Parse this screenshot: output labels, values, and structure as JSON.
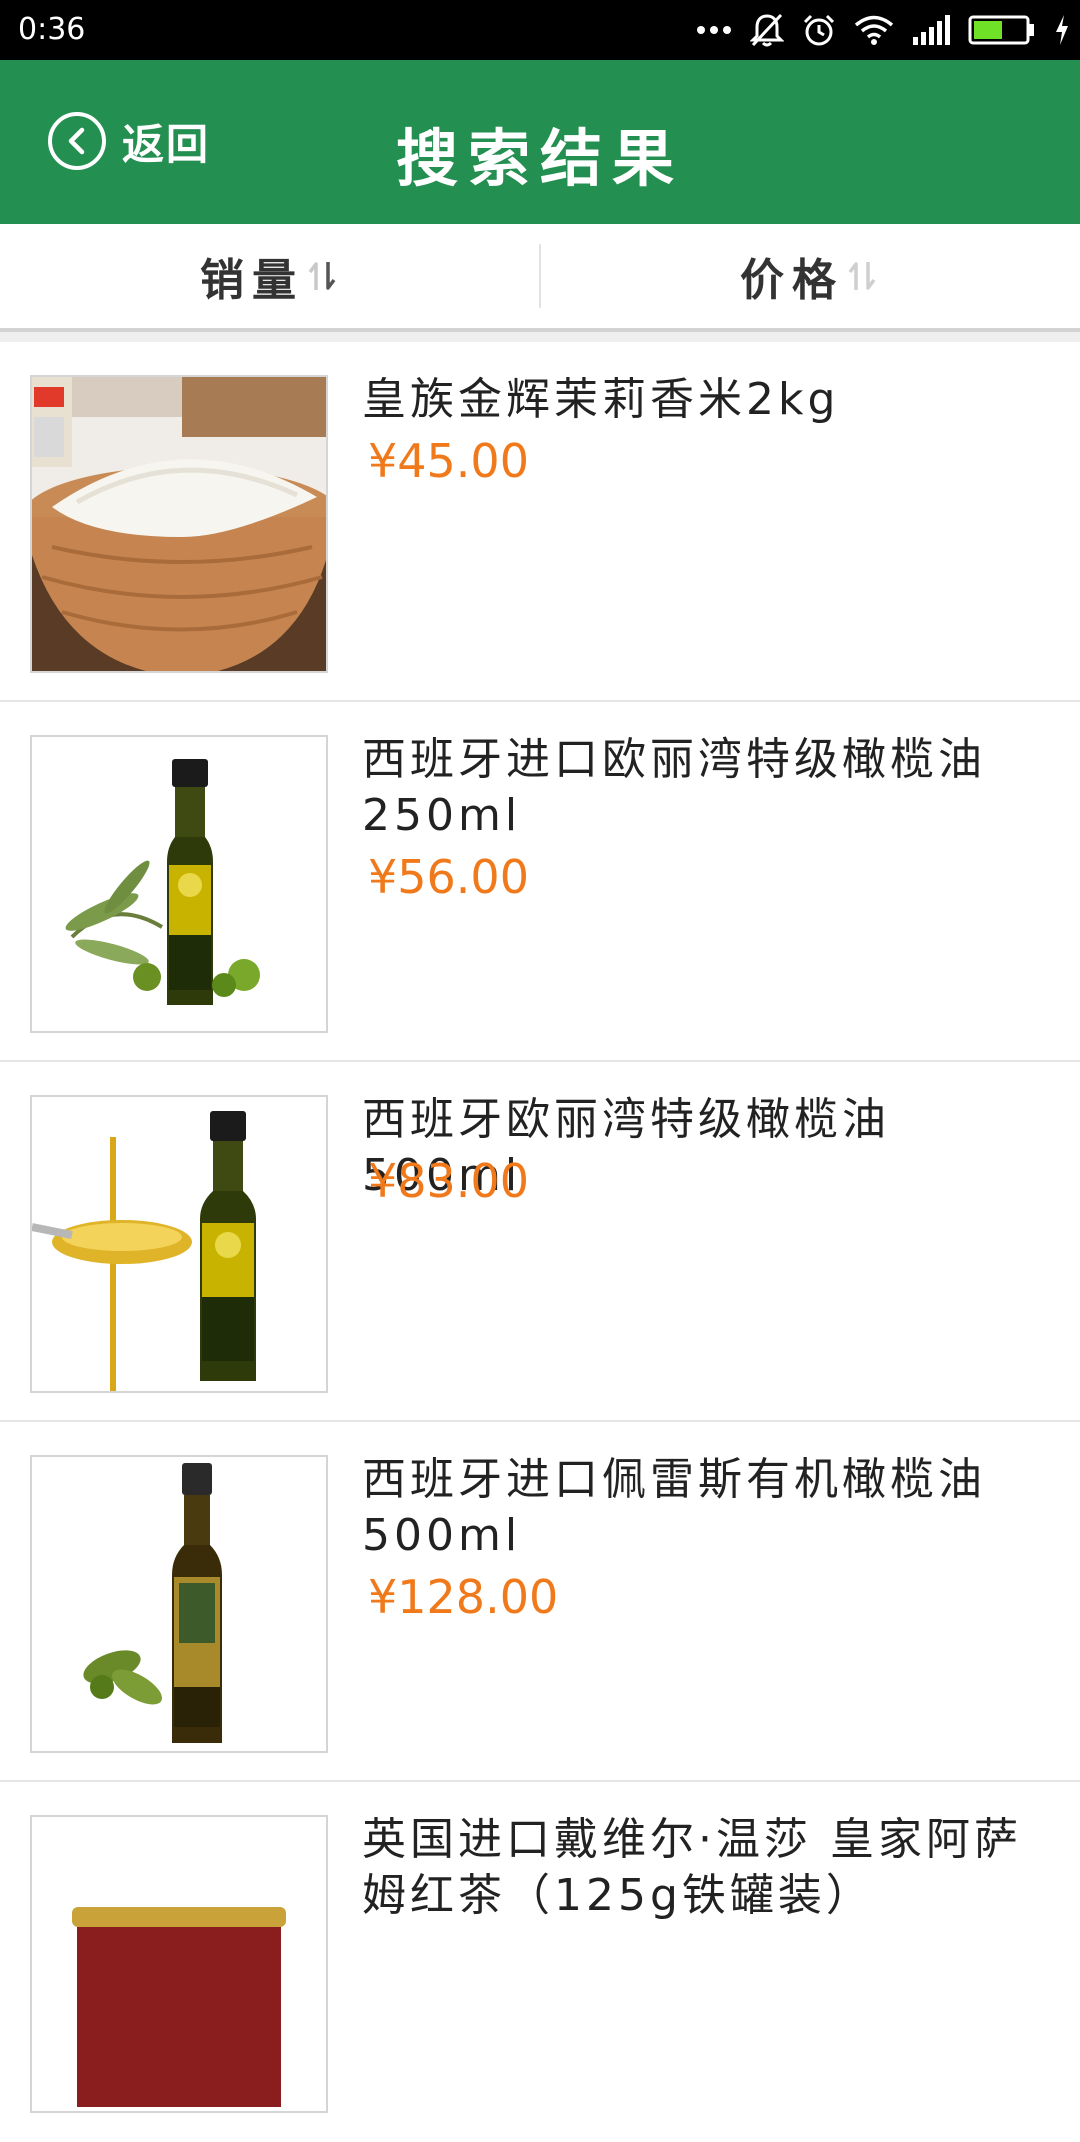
{
  "status_bar": {
    "time": "0:36",
    "icons": [
      "more-dots-icon",
      "mute-bell-icon",
      "alarm-icon",
      "wifi-icon",
      "signal-icon",
      "battery-icon",
      "charging-icon"
    ]
  },
  "header": {
    "back_label": "返回",
    "title": "搜索结果",
    "background_color": "#238f51"
  },
  "sort": {
    "sales_label": "销量",
    "price_label": "价格"
  },
  "products": [
    {
      "name": "皇族金辉茉莉香米2kg",
      "price": "¥45.00",
      "image": "rice-bowl"
    },
    {
      "name": "西班牙进口欧丽湾特级橄榄油250ml",
      "price": "¥56.00",
      "image": "olive-oil-bottle-with-leaves"
    },
    {
      "name": "西班牙欧丽湾特级橄榄油500ml",
      "price": "¥83.00",
      "image": "olive-oil-bottle-with-spoon"
    },
    {
      "name": "西班牙进口佩雷斯有机橄榄油500ml",
      "price": "¥128.00",
      "image": "organic-olive-oil-bottle"
    },
    {
      "name": "英国进口戴维尔·温莎 皇家阿萨姆红茶（125g铁罐装）",
      "price": "",
      "image": "tea-tin"
    }
  ],
  "colors": {
    "price": "#f07a1b",
    "accent": "#238f51"
  }
}
